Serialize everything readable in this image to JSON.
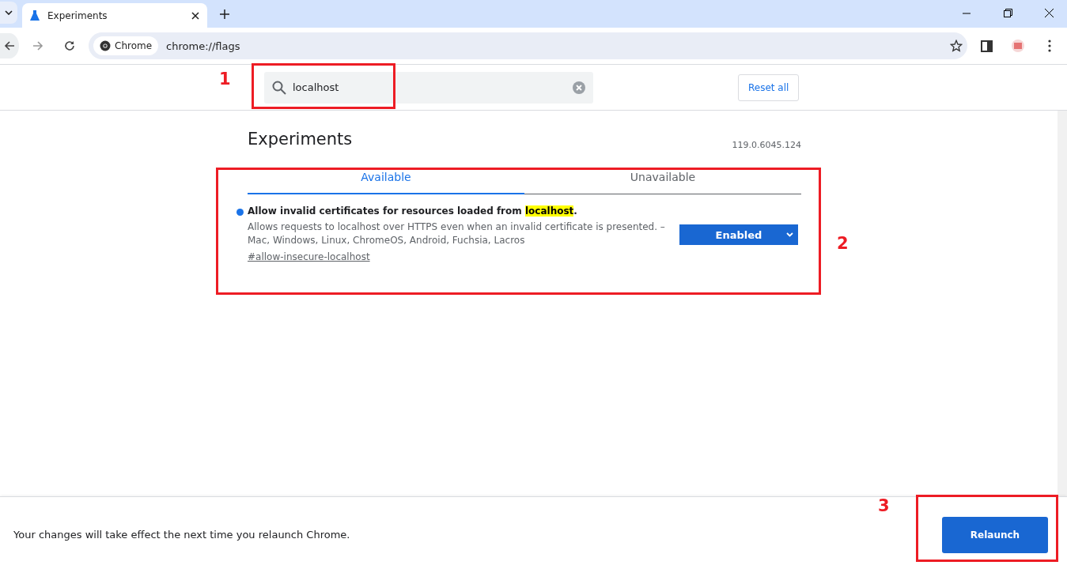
{
  "browser": {
    "tabs": [
      {
        "title": "Experiments",
        "selected": true
      }
    ],
    "omnibox": {
      "chip": "Chrome",
      "url": "chrome://flags"
    }
  },
  "search": {
    "value": "localhost"
  },
  "reset_button": "Reset all",
  "page": {
    "title": "Experiments",
    "version": "119.0.6045.124"
  },
  "tabs": [
    {
      "label": "Available",
      "selected": true
    },
    {
      "label": "Unavailable",
      "selected": false
    }
  ],
  "flags": [
    {
      "title_parts": [
        {
          "text": "Allow invalid certificates for resources loaded from ",
          "highlighted": false
        },
        {
          "text": "localhost",
          "highlighted": true
        },
        {
          "text": ".",
          "highlighted": false
        }
      ],
      "modified": true,
      "description": "Allows requests to localhost over HTTPS even when an invalid certificate is presented. – Mac, Windows, Linux, ChromeOS, Android, Fuchsia, Lacros",
      "link": "#allow-insecure-localhost",
      "value": "Enabled"
    }
  ],
  "footer": {
    "message": "Your changes will take effect the next time you relaunch Chrome.",
    "button": "Relaunch"
  },
  "annotations": [
    {
      "number": "1"
    },
    {
      "number": "2"
    },
    {
      "number": "3"
    }
  ]
}
